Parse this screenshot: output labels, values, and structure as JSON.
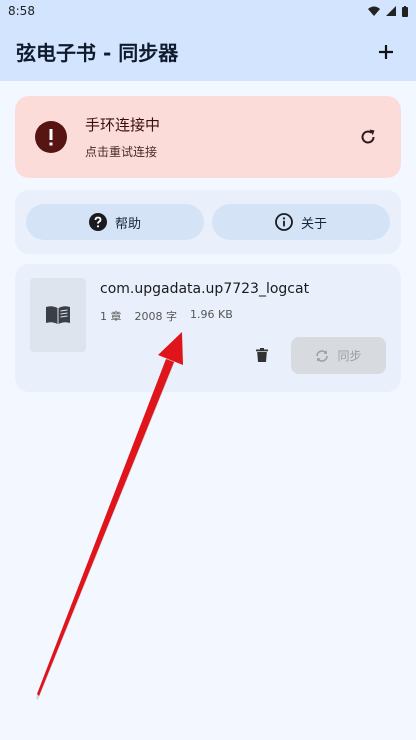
{
  "status_bar": {
    "time": "8:58"
  },
  "app_bar": {
    "title": "弦电子书 - 同步器"
  },
  "connection_card": {
    "title": "手环连接中",
    "subtitle": "点击重试连接"
  },
  "actions": {
    "help_label": "帮助",
    "about_label": "关于"
  },
  "book": {
    "title": "com.upgadata.up7723_logcat",
    "chapters": "1 章",
    "chars": "2008 字",
    "size": "1.96 KB",
    "sync_label": "同步"
  },
  "colors": {
    "app_bar": "#d3e4ff",
    "error_card": "#fbdcd9",
    "error_icon": "#561512",
    "card": "#e9f0fb",
    "pill": "#d5e3f7",
    "arrow": "#e0141b"
  }
}
